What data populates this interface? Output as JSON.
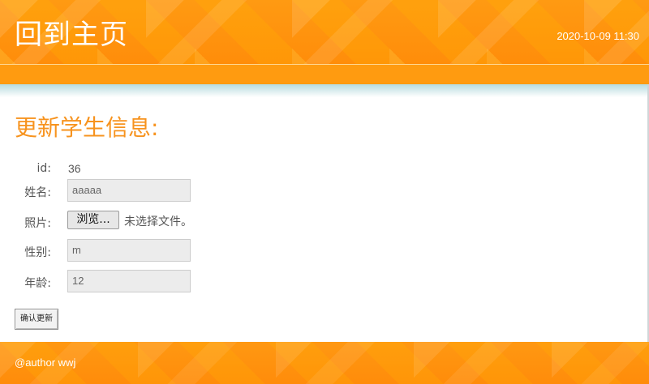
{
  "header": {
    "home_link": "回到主页",
    "datetime": "2020-10-09 11:30"
  },
  "main": {
    "title": "更新学生信息:",
    "form": {
      "id_label": "id:",
      "id_value": "36",
      "name_label": "姓名:",
      "name_value": "aaaaa",
      "photo_label": "照片:",
      "browse_label": "浏览...",
      "no_file_text": "未选择文件。",
      "gender_label": "性别:",
      "gender_value": "m",
      "age_label": "年龄:",
      "age_value": "12",
      "submit_label": "确认更新"
    }
  },
  "footer": {
    "text": "@author wwj"
  }
}
